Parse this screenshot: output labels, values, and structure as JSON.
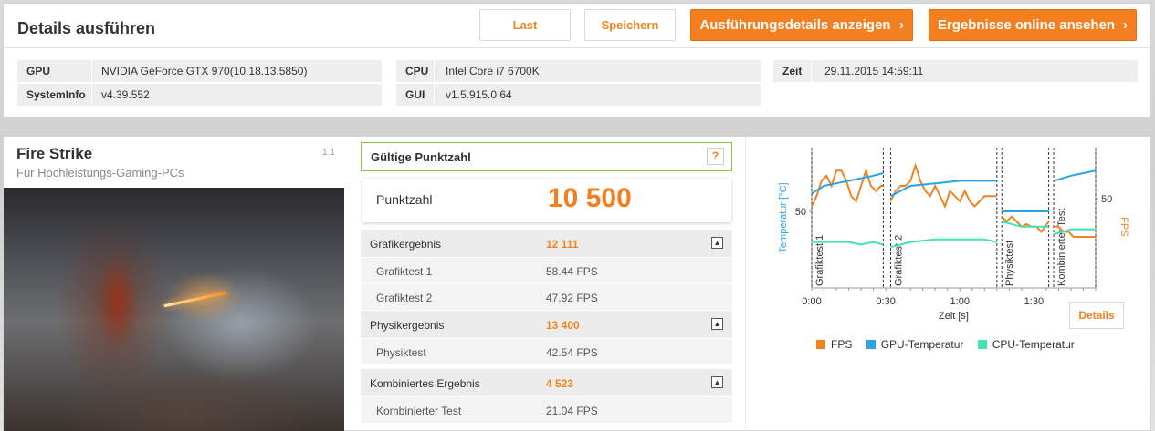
{
  "header": {
    "title": "Details ausführen",
    "buttons": {
      "load": "Last",
      "save": "Speichern",
      "show_details": "Ausführungsdetails anzeigen",
      "view_online": "Ergebnisse online ansehen"
    }
  },
  "system_info": {
    "gpu_label": "GPU",
    "gpu_value": "NVIDIA GeForce GTX 970(10.18.13.5850)",
    "sysinfo_label": "SystemInfo",
    "sysinfo_value": "v4.39.552",
    "cpu_label": "CPU",
    "cpu_value": "Intel Core i7 6700K",
    "gui_label": "GUI",
    "gui_value": "v1.5.915.0 64",
    "time_label": "Zeit",
    "time_value": "29.11.2015 14:59:11"
  },
  "benchmark": {
    "name": "Fire Strike",
    "subtitle": "Für Hochleistungs-Gaming-PCs",
    "version": "1.1"
  },
  "score": {
    "valid_label": "Gültige Punktzahl",
    "help": "?",
    "label": "Punktzahl",
    "value": "10 500"
  },
  "results": {
    "graphics": {
      "label": "Grafikergebnis",
      "value": "12 111",
      "tests": [
        {
          "label": "Grafiktest 1",
          "value": "58.44 FPS"
        },
        {
          "label": "Grafiktest 2",
          "value": "47.92 FPS"
        }
      ]
    },
    "physics": {
      "label": "Physikergebnis",
      "value": "13 400",
      "tests": [
        {
          "label": "Physiktest",
          "value": "42.54 FPS"
        }
      ]
    },
    "combined": {
      "label": "Kombiniertes Ergebnis",
      "value": "4 523",
      "tests": [
        {
          "label": "Kombinierter Test",
          "value": "21.04 FPS"
        }
      ]
    }
  },
  "chart": {
    "details_button": "Details",
    "legend": [
      "FPS",
      "GPU-Temperatur",
      "CPU-Temperatur"
    ]
  },
  "colors": {
    "accent": "#f47f20",
    "fps": "#f08320",
    "gpu_temp": "#29a3e6",
    "cpu_temp": "#3ee3b8"
  },
  "chart_data": {
    "type": "line",
    "xlabel": "Zeit [s]",
    "ylabel_left": "Temperatur [°C]",
    "ylabel_right": "FPS",
    "x_ticks": [
      "0:00",
      "0:30",
      "1:00",
      "1:30"
    ],
    "x_range": [
      0,
      115
    ],
    "left_ticks": [
      "50"
    ],
    "right_ticks": [
      "50"
    ],
    "segments": [
      "Grafiktest 1",
      "Grafiktest 2",
      "Physiktest",
      "Kombinierter Test"
    ],
    "segment_bounds_s": [
      [
        0,
        29
      ],
      [
        32,
        75
      ],
      [
        77,
        96
      ],
      [
        98,
        115
      ]
    ],
    "series": [
      {
        "name": "FPS",
        "x": [
          0,
          2,
          4,
          6,
          8,
          10,
          12,
          14,
          16,
          18,
          20,
          22,
          24,
          26,
          28,
          29,
          32,
          34,
          36,
          38,
          40,
          42,
          44,
          46,
          48,
          50,
          52,
          54,
          56,
          58,
          60,
          62,
          64,
          66,
          68,
          70,
          72,
          75,
          77,
          79,
          81,
          83,
          85,
          87,
          89,
          91,
          93,
          96,
          98,
          100,
          102,
          104,
          106,
          108,
          110,
          112,
          115
        ],
        "y": [
          52,
          56,
          62,
          64,
          60,
          66,
          66,
          62,
          56,
          54,
          60,
          66,
          60,
          58,
          60,
          60,
          54,
          58,
          60,
          60,
          62,
          68,
          62,
          58,
          56,
          60,
          56,
          52,
          58,
          56,
          54,
          58,
          54,
          52,
          54,
          56,
          56,
          56,
          48,
          46,
          48,
          46,
          44,
          45,
          44,
          44,
          42,
          46,
          44,
          44,
          42,
          42,
          40,
          40,
          40,
          40,
          40
        ]
      },
      {
        "name": "GPU-Temperatur",
        "x": [
          0,
          5,
          10,
          15,
          20,
          25,
          29,
          32,
          40,
          50,
          60,
          70,
          75,
          77,
          85,
          96,
          98,
          105,
          110,
          115
        ],
        "y": [
          57,
          60,
          61,
          62,
          63,
          64,
          65,
          56,
          60,
          61,
          62,
          62,
          62,
          50,
          50,
          50,
          62,
          64,
          65,
          66
        ]
      },
      {
        "name": "CPU-Temperatur",
        "x": [
          0,
          5,
          10,
          15,
          20,
          25,
          29,
          32,
          40,
          50,
          60,
          70,
          75,
          77,
          85,
          96,
          98,
          105,
          110,
          115
        ],
        "y": [
          38,
          38,
          38,
          38,
          37,
          38,
          37,
          36,
          38,
          39,
          39,
          39,
          38,
          46,
          44,
          44,
          41,
          43,
          43,
          43
        ]
      }
    ]
  }
}
